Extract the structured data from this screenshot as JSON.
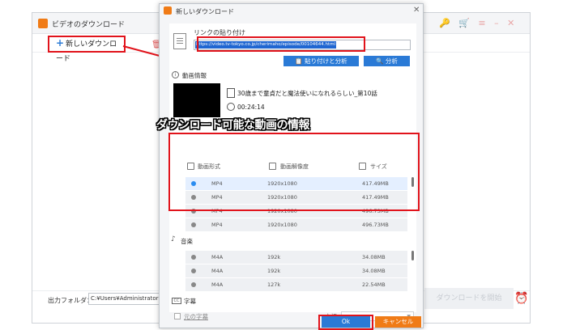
{
  "app": {
    "title": "ビデオのダウンロード",
    "new_download": "新しいダウンロード",
    "output_folder_label": "出力フォルダ：",
    "output_folder_value": "C:¥Users¥Administrator¥Videos",
    "download_all": "ダウンロードを開始"
  },
  "dialog": {
    "title": "新しいダウンロード",
    "paste_label": "リンクの貼り付け",
    "url": "https://video.tv-tokyo.co.jp/cherimaho/episode/00104644.html",
    "paste_analyze_button": "貼り付けと分析",
    "analyze_button": "分析",
    "info_label": "動画情報",
    "video_title": "30歳まで童貞だと魔法使いになれるらしい_第10話",
    "video_duration": "00:24:14",
    "video_headers": {
      "format": "動画形式",
      "resolution": "動画解像度",
      "size": "サイズ"
    },
    "video_rows": [
      {
        "format": "MP4",
        "resolution": "1920x1080",
        "size": "417.49MB",
        "selected": true
      },
      {
        "format": "MP4",
        "resolution": "1920x1080",
        "size": "417.49MB",
        "selected": false
      },
      {
        "format": "MP4",
        "resolution": "1920x1080",
        "size": "496.73MB",
        "selected": false
      },
      {
        "format": "MP4",
        "resolution": "1920x1080",
        "size": "496.73MB",
        "selected": false
      }
    ],
    "audio_label": "音楽",
    "audio_rows": [
      {
        "format": "M4A",
        "bitrate": "192k",
        "size": "34.08MB"
      },
      {
        "format": "M4A",
        "bitrate": "192k",
        "size": "34.08MB"
      },
      {
        "format": "M4A",
        "bitrate": "127k",
        "size": "22.54MB"
      }
    ],
    "subtitle_label": "字幕",
    "original_subtitle": "元の字幕",
    "language_label": "言語",
    "ok_button": "Ok",
    "cancel_button": "キャンセル"
  },
  "annotation": {
    "caption": "ダウンロード可能な動画の情報"
  },
  "colors": {
    "accent": "#2a7ad6",
    "brand_orange": "#f07b16",
    "highlight_red": "#e1131b"
  }
}
